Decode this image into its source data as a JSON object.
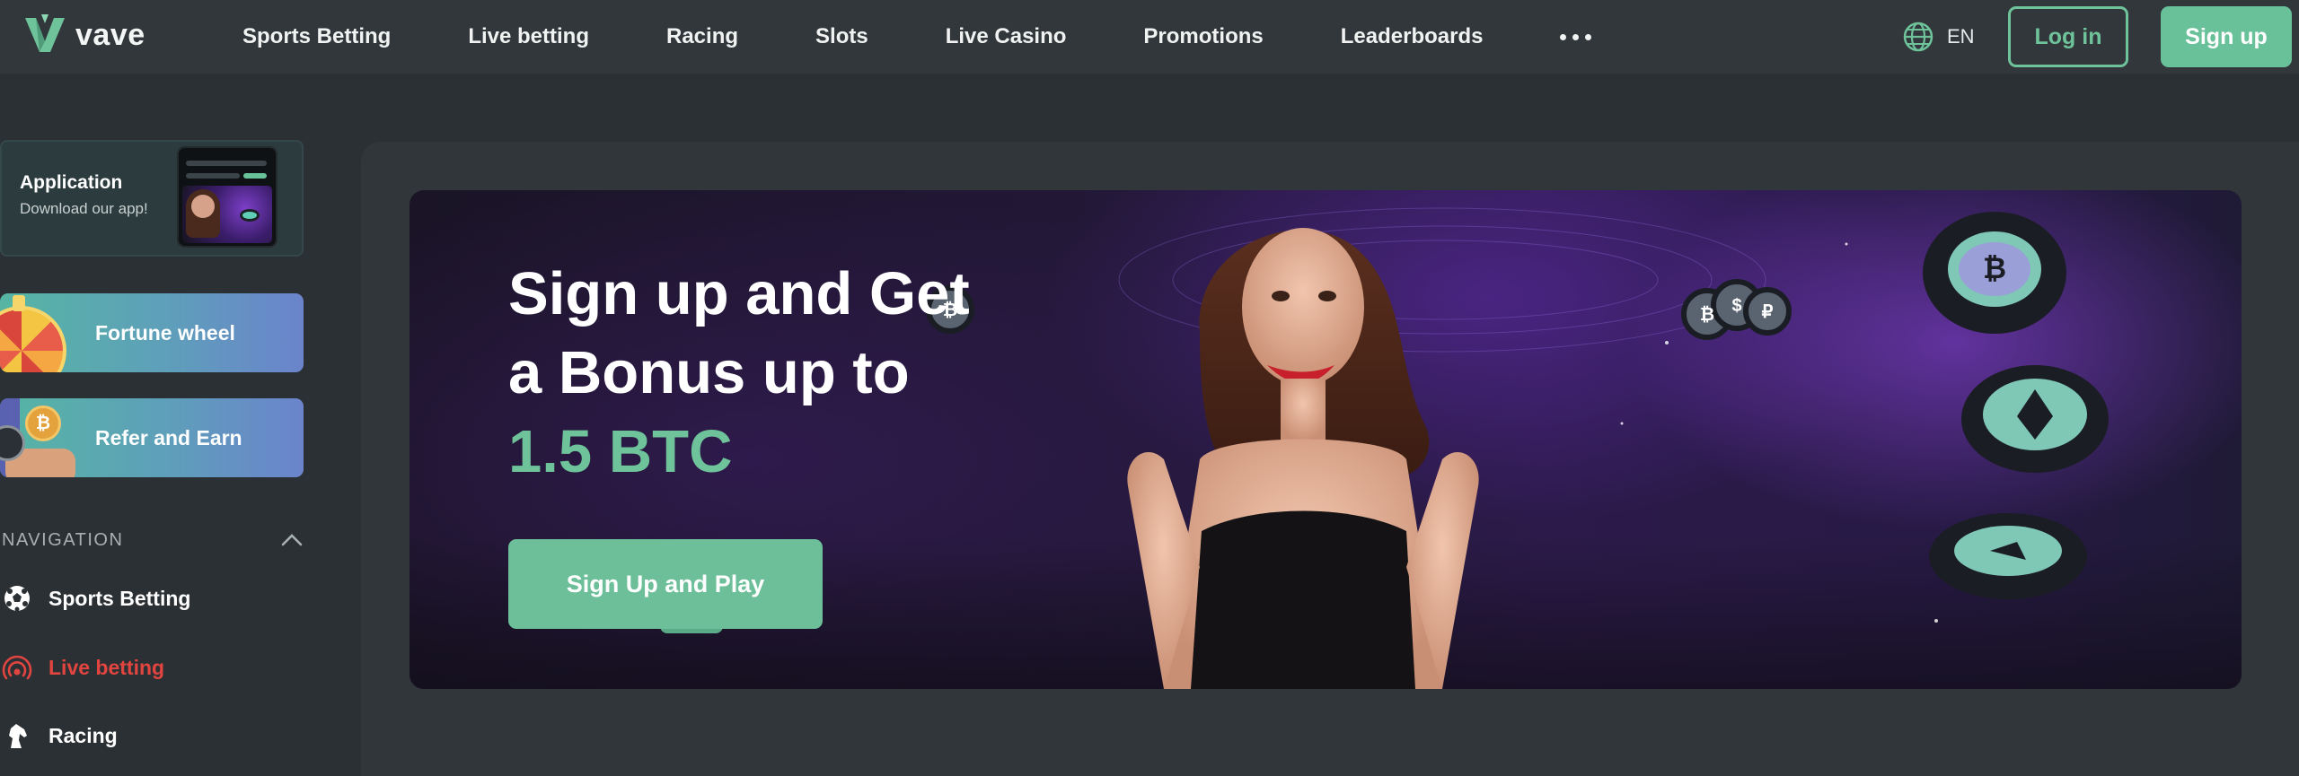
{
  "header": {
    "logo_text": "vave",
    "nav": [
      "Sports Betting",
      "Live betting",
      "Racing",
      "Slots",
      "Live Casino",
      "Promotions",
      "Leaderboards"
    ],
    "language": "EN",
    "login_label": "Log in",
    "signup_label": "Sign up"
  },
  "sidebar": {
    "app": {
      "title": "Application",
      "subtitle": "Download our app!"
    },
    "fortune_wheel": "Fortune wheel",
    "refer": "Refer and Earn",
    "navigation_label": "NAVIGATION",
    "items": [
      {
        "label": "Sports Betting",
        "icon": "soccer-ball-icon",
        "active": false
      },
      {
        "label": "Live betting",
        "icon": "live-signal-icon",
        "active": true
      },
      {
        "label": "Racing",
        "icon": "horse-icon",
        "active": false
      }
    ]
  },
  "banner": {
    "line1": "Sign up and Get",
    "line2": "a Bonus up to",
    "line3": "1.5 BTC",
    "cta": "Sign Up and Play"
  },
  "colors": {
    "accent": "#6fc39b",
    "active_red": "#e2453f",
    "background": "#2b3034",
    "header": "#31373b"
  }
}
